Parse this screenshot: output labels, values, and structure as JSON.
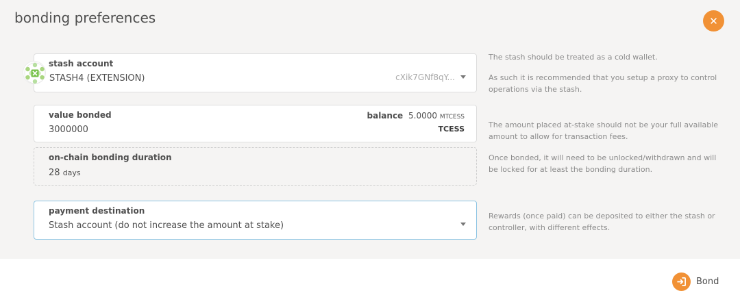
{
  "modal": {
    "title": "bonding preferences",
    "close_icon": "close-icon",
    "accent_color": "#f19135"
  },
  "stash": {
    "label": "stash account",
    "value": "STASH4 (EXTENSION)",
    "address": "cXik7GNf8qY...",
    "avatar_icon": "identicon-avatar",
    "help": [
      "The stash should be treated as a cold wallet.",
      "As such it is recommended that you setup a proxy to control operations via the stash."
    ]
  },
  "value_bonded": {
    "label": "value bonded",
    "value": "3000000",
    "balance_label": "balance",
    "balance_value": "5.0000",
    "balance_unit": "MTCESS",
    "unit": "TCESS",
    "help": "The amount placed at-stake should not be your full available amount to allow for transaction fees."
  },
  "duration": {
    "label": "on-chain bonding duration",
    "value": "28",
    "unit": "days",
    "help": "Once bonded, it will need to be unlocked/withdrawn and will be locked for at least the bonding duration."
  },
  "payment": {
    "label": "payment destination",
    "value": "Stash account (do not increase the amount at stake)",
    "help": "Rewards (once paid) can be deposited to either the stash or controller, with different effects."
  },
  "footer": {
    "bond_label": "Bond",
    "bond_icon": "sign-in-icon"
  }
}
